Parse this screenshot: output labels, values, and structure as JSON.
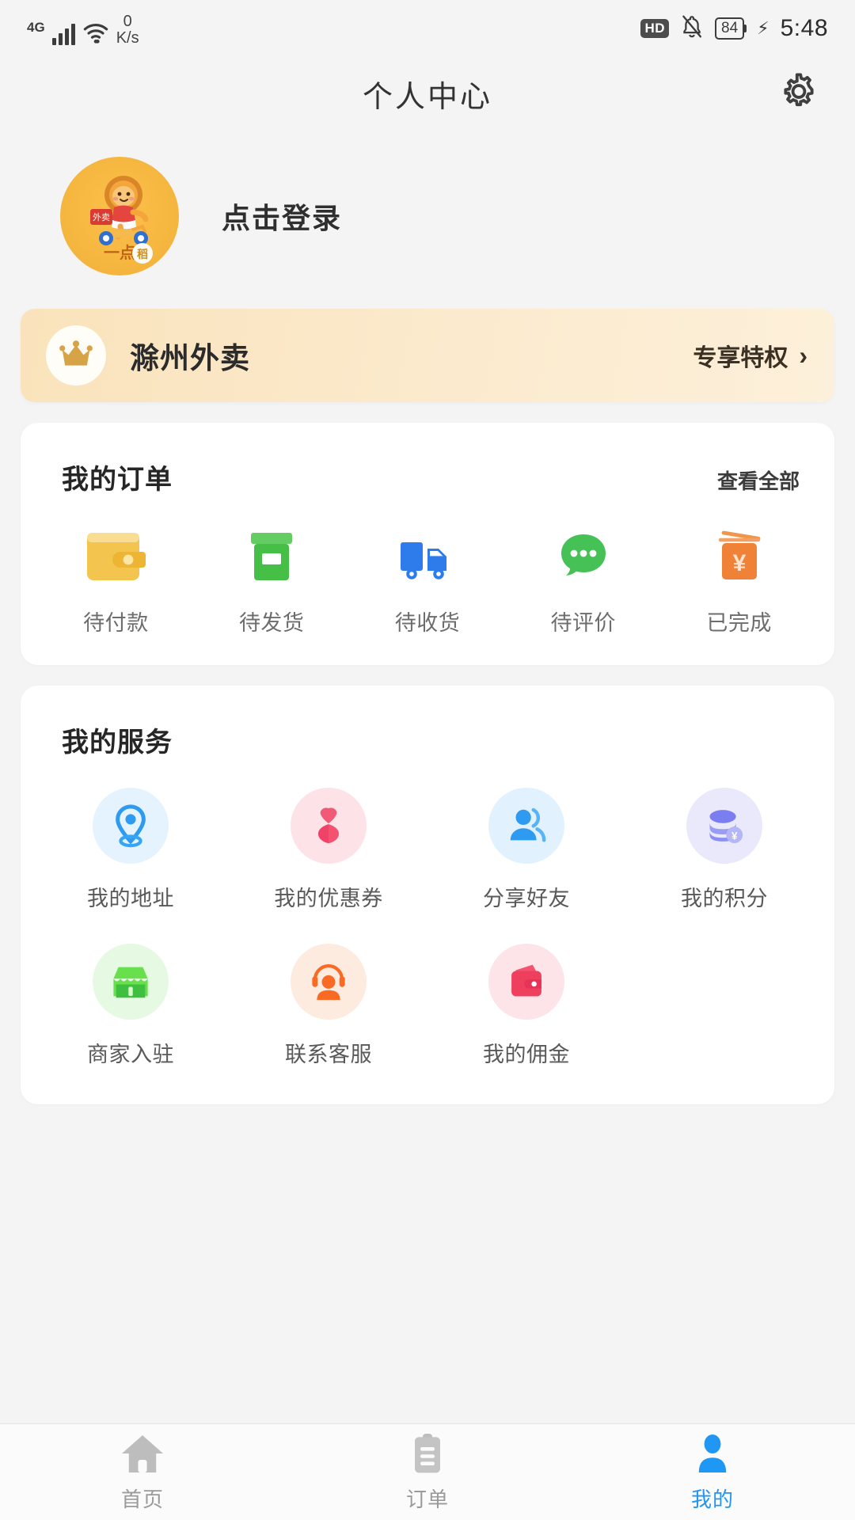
{
  "status_bar": {
    "network_type": "4G",
    "speed_value": "0",
    "speed_unit": "K/s",
    "hd_label": "HD",
    "battery_level": "84",
    "charging_icon": "bolt-icon",
    "time": "5:48",
    "icons": [
      "signal-bars-icon",
      "wifi-icon",
      "hd-icon",
      "bell-muted-icon",
      "battery-icon",
      "bolt-icon"
    ]
  },
  "header": {
    "title": "个人中心",
    "settings_icon": "gear-icon"
  },
  "profile": {
    "avatar_icon": "lion-scooter-avatar",
    "avatar_brand_text": "一点稻",
    "avatar_box_text": "外卖",
    "login_label": "点击登录"
  },
  "vip_banner": {
    "crown_icon": "crown-icon",
    "name": "滁州外卖",
    "action_label": "专享特权",
    "chevron": "›",
    "bg_start": "#fae3bb",
    "bg_end": "#fdf0da"
  },
  "orders_card": {
    "title": "我的订单",
    "more_label": "查看全部",
    "items": [
      {
        "label": "待付款",
        "icon": "wallet-icon",
        "color": "#f5c344"
      },
      {
        "label": "待发货",
        "icon": "package-box-icon",
        "color": "#4cbd4c"
      },
      {
        "label": "待收货",
        "icon": "delivery-truck-icon",
        "color": "#2e7bec"
      },
      {
        "label": "待评价",
        "icon": "chat-bubble-icon",
        "color": "#45c155"
      },
      {
        "label": "已完成",
        "icon": "receipt-yuan-icon",
        "color": "#f08238"
      }
    ]
  },
  "services_card": {
    "title": "我的服务",
    "items": [
      {
        "label": "我的地址",
        "icon": "location-pin-icon",
        "color": "#35a6f5",
        "bg": "#e4f3fd"
      },
      {
        "label": "我的优惠券",
        "icon": "coupon-heart-icon",
        "color": "#f4536f",
        "bg": "#fde3e8"
      },
      {
        "label": "分享好友",
        "icon": "share-friends-icon",
        "color": "#2f9bf0",
        "bg": "#e1f1fd"
      },
      {
        "label": "我的积分",
        "icon": "coins-yuan-icon",
        "color": "#7b7ef0",
        "bg": "#e9e9fb"
      },
      {
        "label": "商家入驻",
        "icon": "storefront-icon",
        "color": "#5fd34a",
        "bg": "#e6f9e2"
      },
      {
        "label": "联系客服",
        "icon": "headset-support-icon",
        "color": "#fa6a23",
        "bg": "#fdebe0"
      },
      {
        "label": "我的佣金",
        "icon": "commission-wallet-icon",
        "color": "#ef3f5f",
        "bg": "#fde4e8"
      }
    ]
  },
  "tabbar": {
    "active_color": "#2196f3",
    "inactive_color": "#9a9a9a",
    "tabs": [
      {
        "label": "首页",
        "icon": "home-icon",
        "active": false
      },
      {
        "label": "订单",
        "icon": "clipboard-orders-icon",
        "active": false
      },
      {
        "label": "我的",
        "icon": "person-icon",
        "active": true
      }
    ]
  }
}
